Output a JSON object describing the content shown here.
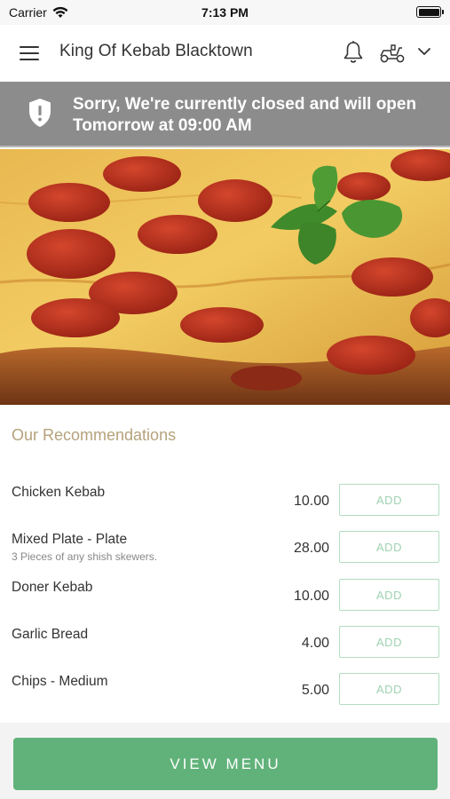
{
  "status_bar": {
    "carrier": "Carrier",
    "time": "7:13 PM"
  },
  "header": {
    "title": "King Of Kebab Blacktown",
    "icons": [
      "menu-icon",
      "bell-icon",
      "delivery-scooter-icon",
      "chevron-down-icon"
    ]
  },
  "closed_banner": {
    "line1": "Sorry, We're currently closed and will open",
    "line2": "Tomorrow at 09:00 AM",
    "icon": "shield-alert-icon"
  },
  "recommendations": {
    "title": "Our Recommendations",
    "items": [
      {
        "name": "Chicken Kebab",
        "description": "",
        "price": "10.00",
        "add_label": "ADD"
      },
      {
        "name": "Mixed Plate - Plate",
        "description": "3 Pieces of any shish skewers.",
        "price": "28.00",
        "add_label": "ADD"
      },
      {
        "name": "Doner Kebab",
        "description": "",
        "price": "10.00",
        "add_label": "ADD"
      },
      {
        "name": "Garlic Bread",
        "description": "",
        "price": "4.00",
        "add_label": "ADD"
      },
      {
        "name": "Chips - Medium",
        "description": "",
        "price": "5.00",
        "add_label": "ADD"
      }
    ]
  },
  "footer": {
    "view_menu_label": "VIEW MENU"
  },
  "colors": {
    "banner": "#8c8c8c",
    "accent_green": "#61b27a",
    "add_border": "#b4dcc0",
    "section_title": "#b5a27c"
  }
}
